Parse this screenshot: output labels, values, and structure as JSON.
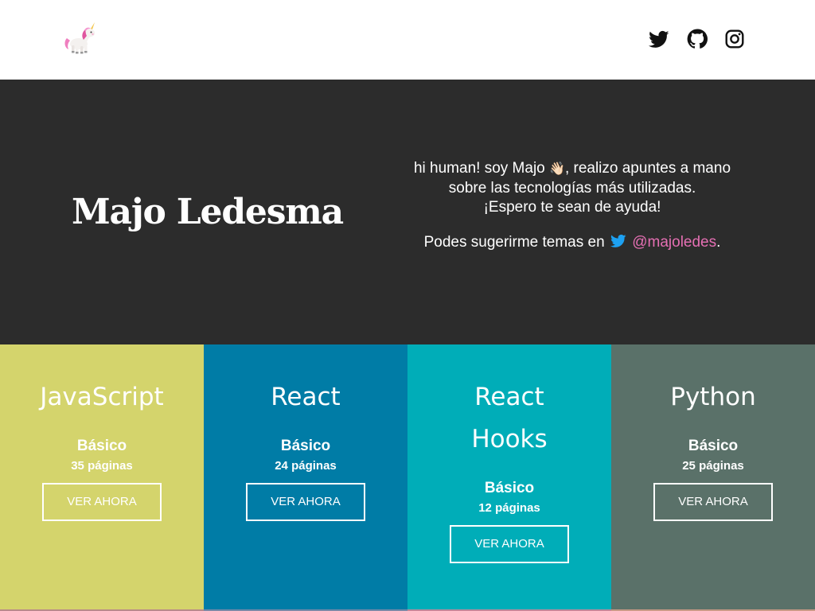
{
  "header": {
    "logo_icon": "unicorn-icon",
    "social": [
      {
        "name": "twitter-icon"
      },
      {
        "name": "github-icon"
      },
      {
        "name": "instagram-icon"
      }
    ]
  },
  "hero": {
    "title": "Majo Ledesma",
    "line1_before": "hi human! soy Majo",
    "wave": "👋🏻",
    "line1_after": ", realizo apuntes a mano",
    "line2": "sobre las tecnologías más utilizadas.",
    "line3": "¡Espero te sean de ayuda!",
    "suggest_prefix": "Podes sugerirme temas en",
    "handle": "@majoledes",
    "suggest_suffix": ".",
    "handle_color": "#e56fb3",
    "background": "#2c2c2c"
  },
  "cards": [
    {
      "title": "JavaScript",
      "level": "Básico",
      "pages": "35 páginas",
      "button": "VER AHORA",
      "color": "#d4d46c"
    },
    {
      "title": "React",
      "level": "Básico",
      "pages": "24 páginas",
      "button": "VER AHORA",
      "color": "#007ca6"
    },
    {
      "title": "React Hooks",
      "level": "Básico",
      "pages": "12 páginas",
      "button": "VER AHORA",
      "color": "#00adb8"
    },
    {
      "title": "Python",
      "level": "Básico",
      "pages": "25 páginas",
      "button": "VER AHORA",
      "color": "#5a7169"
    }
  ]
}
